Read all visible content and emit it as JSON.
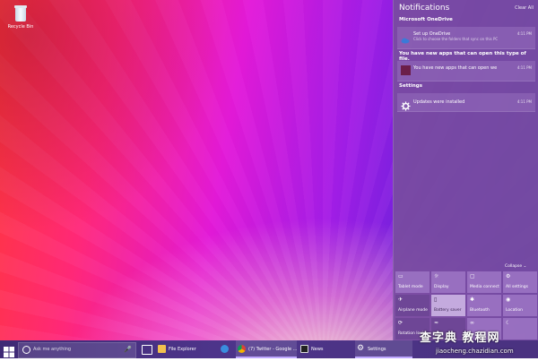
{
  "desktop": {
    "recycle_bin_label": "Recycle Bin"
  },
  "action_center": {
    "title": "Notifications",
    "clear_all": "Clear All",
    "groups": [
      {
        "title": "Microsoft OneDrive",
        "items": [
          {
            "title": "Set up OneDrive",
            "subtitle": "Click to choose the folders that sync on this PC",
            "time": "4:11 PM",
            "icon": "onedrive-icon"
          }
        ]
      },
      {
        "title": "You have new apps that can open this type of file.",
        "items": [
          {
            "title": "You have new apps that can open we",
            "subtitle": "",
            "time": "4:11 PM",
            "icon": "app-icon"
          }
        ]
      },
      {
        "title": "Settings",
        "items": [
          {
            "title": "Updates were installed",
            "subtitle": "",
            "time": "4:11 PM",
            "icon": "gear-icon"
          }
        ]
      }
    ],
    "collapse_label": "Collapse",
    "quick_actions": [
      {
        "label": "Tablet mode",
        "icon": "tablet-icon",
        "state": "off"
      },
      {
        "label": "Display",
        "icon": "display-icon",
        "state": "off"
      },
      {
        "label": "Media connect",
        "icon": "cast-icon",
        "state": "off"
      },
      {
        "label": "All settings",
        "icon": "gear-icon",
        "state": "off"
      },
      {
        "label": "Airplane mode",
        "icon": "airplane-icon",
        "state": "off"
      },
      {
        "label": "Battery saver",
        "icon": "battery-icon",
        "state": "highlight"
      },
      {
        "label": "Bluetooth",
        "icon": "bluetooth-icon",
        "state": "off"
      },
      {
        "label": "Location",
        "icon": "location-icon",
        "state": "off"
      },
      {
        "label": "Rotation lock",
        "icon": "rotation-icon",
        "state": "off"
      },
      {
        "label": "",
        "icon": "wifi-icon",
        "state": "off"
      },
      {
        "label": "",
        "icon": "vpn-icon",
        "state": "off"
      },
      {
        "label": "",
        "icon": "quiet-hours-icon",
        "state": "off"
      }
    ]
  },
  "taskbar": {
    "search_placeholder": "Ask me anything",
    "apps": [
      {
        "label": "File Explorer",
        "icon": "folder-icon",
        "color": "#f2c14e"
      },
      {
        "label": "",
        "icon": "edge-icon",
        "color": "#3a8dde"
      },
      {
        "label": "(7) Twitter - Google ...",
        "icon": "chrome-icon",
        "color": "#f4b400"
      },
      {
        "label": "News",
        "icon": "news-icon",
        "color": "#222222"
      },
      {
        "label": "Settings",
        "icon": "gear-icon",
        "color": "#ffffff"
      }
    ]
  },
  "watermark": {
    "line1": "查字典 教程网",
    "line2": "jiaocheng.chazidian.com"
  }
}
